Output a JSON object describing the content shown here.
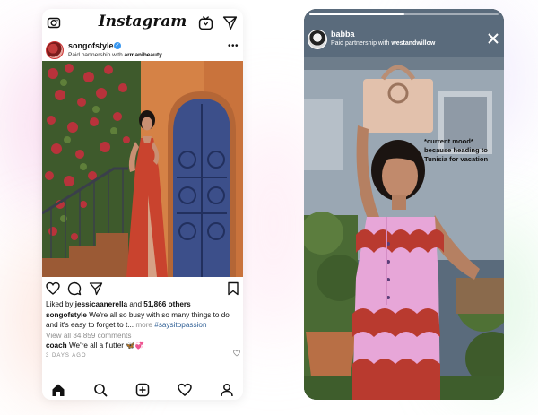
{
  "colors": {
    "verified_blue": "#3897f0",
    "hashtag_blue": "#2f5f95",
    "muted_gray": "#8e8e8e",
    "dress_red": "#c9432e",
    "wall_orange": "#d07a45",
    "door_navy": "#3c4f8a",
    "top_pink": "#e7a6d8",
    "wave_red": "#b93a2f"
  },
  "feed": {
    "app_title": "Instagram",
    "icons": {
      "camera": "camera-icon",
      "igtv": "igtv-icon",
      "direct": "paper-plane-icon",
      "more": "more-dots-icon",
      "like": "heart-icon",
      "comment": "comment-icon",
      "share": "paper-plane-icon",
      "save": "bookmark-icon",
      "home": "home-icon",
      "search": "search-icon",
      "new_post": "plus-square-icon",
      "activity": "heart-icon",
      "profile": "profile-icon"
    },
    "post": {
      "username": "songofstyle",
      "partner_prefix": "Paid partnership with ",
      "partner_name": "armanibeauty",
      "more_label": "•••",
      "likes_prefix": "Liked by ",
      "likes_user": "jessicaanerella",
      "likes_mid": " and ",
      "likes_count": "51,866 others",
      "caption_user": "songofstyle",
      "caption_text": " We're all so busy with so many things to do and it's easy to forget to t... ",
      "caption_more": "more",
      "caption_hashtag": " #saysitopassion",
      "view_comments": "View all 34,859 comments",
      "comment_user": "coach",
      "comment_text": " We're all a flutter 🦋💞",
      "timestamp": "3 DAYS AGO"
    }
  },
  "story": {
    "username": "babba",
    "partner_prefix": "Paid partnership with ",
    "partner_name": "westandwillow",
    "close_icon": "close-icon",
    "progress": 0.5,
    "overlay_text": [
      "*current mood*",
      "because heading to",
      "Tunisia for vacation"
    ]
  }
}
